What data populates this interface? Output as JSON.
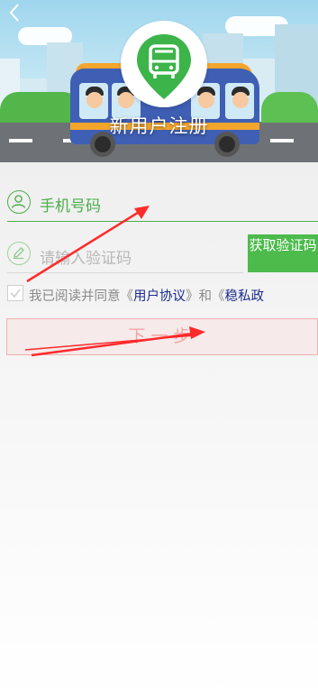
{
  "header": {
    "title": "新用户注册"
  },
  "form": {
    "phone_placeholder": "手机号码",
    "code_placeholder": "请输入验证码",
    "get_code_button": "获取验证码",
    "agreement": {
      "prefix": "我已阅读并同意《",
      "user_agreement": "用户协议",
      "middle": "》和《",
      "privacy": "稳私政"
    },
    "next_button": "下一步"
  },
  "colors": {
    "accent": "#4cbb4c",
    "link": "#1c2b8f",
    "annotation_arrow": "#ff2a2a"
  },
  "icons": [
    "back-arrow-icon",
    "bus-logo-icon",
    "user-icon",
    "pencil-icon",
    "checkbox-icon"
  ]
}
